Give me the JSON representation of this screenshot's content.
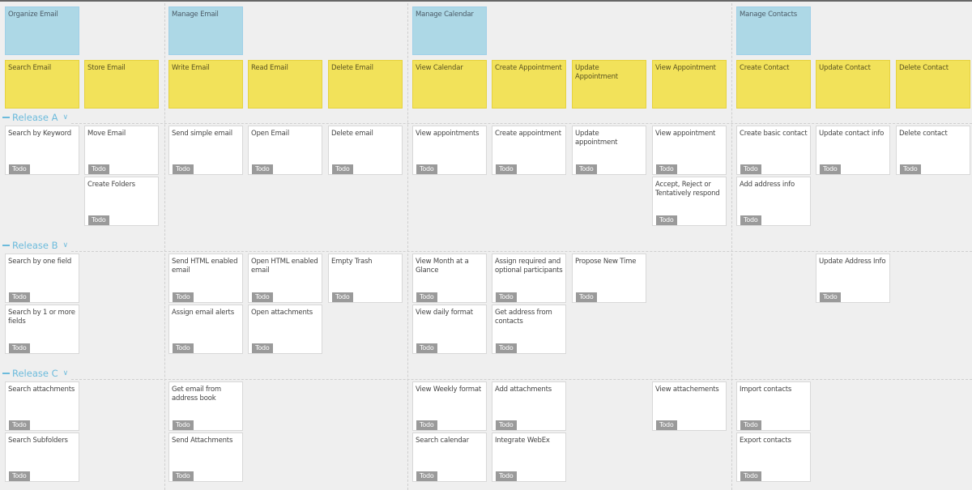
{
  "epics": [
    {
      "label": "Organize Email",
      "col": 0
    },
    {
      "label": "Manage Email",
      "col": 2
    },
    {
      "label": "Manage Calendar",
      "col": 5
    },
    {
      "label": "Manage Contacts",
      "col": 9
    }
  ],
  "features": [
    "Search Email",
    "Store Email",
    "Write Email",
    "Read Email",
    "Delete Email",
    "View Calendar",
    "Create Appointment",
    "Update Appointment",
    "View Appointment",
    "Create Contact",
    "Update Contact",
    "Delete Contact"
  ],
  "status_label": "Todo",
  "releases": [
    {
      "label": "Release A",
      "stories": [
        {
          "col": 0,
          "row": 0,
          "text": "Search by Keyword"
        },
        {
          "col": 1,
          "row": 0,
          "text": "Move Email"
        },
        {
          "col": 1,
          "row": 1,
          "text": "Create Folders"
        },
        {
          "col": 2,
          "row": 0,
          "text": "Send simple email"
        },
        {
          "col": 3,
          "row": 0,
          "text": "Open Email"
        },
        {
          "col": 4,
          "row": 0,
          "text": "Delete email"
        },
        {
          "col": 5,
          "row": 0,
          "text": "View appointments"
        },
        {
          "col": 6,
          "row": 0,
          "text": "Create appointment"
        },
        {
          "col": 7,
          "row": 0,
          "text": "Update appointment"
        },
        {
          "col": 8,
          "row": 0,
          "text": "View appointment"
        },
        {
          "col": 8,
          "row": 1,
          "text": "Accept, Reject or Tentatively respond"
        },
        {
          "col": 9,
          "row": 0,
          "text": "Create basic contact"
        },
        {
          "col": 9,
          "row": 1,
          "text": "Add address info"
        },
        {
          "col": 10,
          "row": 0,
          "text": "Update contact info"
        },
        {
          "col": 11,
          "row": 0,
          "text": "Delete contact"
        }
      ]
    },
    {
      "label": "Release B",
      "stories": [
        {
          "col": 0,
          "row": 0,
          "text": "Search by one field"
        },
        {
          "col": 0,
          "row": 1,
          "text": "Search by 1 or more fields"
        },
        {
          "col": 2,
          "row": 0,
          "text": "Send HTML enabled email"
        },
        {
          "col": 2,
          "row": 1,
          "text": "Assign email alerts"
        },
        {
          "col": 3,
          "row": 0,
          "text": "Open HTML enabled email"
        },
        {
          "col": 3,
          "row": 1,
          "text": "Open attachments"
        },
        {
          "col": 4,
          "row": 0,
          "text": "Empty Trash"
        },
        {
          "col": 5,
          "row": 0,
          "text": "View Month at a Glance"
        },
        {
          "col": 5,
          "row": 1,
          "text": "View daily format"
        },
        {
          "col": 6,
          "row": 0,
          "text": "Assign required and optional participants"
        },
        {
          "col": 6,
          "row": 1,
          "text": "Get address from contacts"
        },
        {
          "col": 7,
          "row": 0,
          "text": "Propose New Time"
        },
        {
          "col": 10,
          "row": 0,
          "text": "Update Address Info"
        }
      ]
    },
    {
      "label": "Release C",
      "stories": [
        {
          "col": 0,
          "row": 0,
          "text": "Search attachments"
        },
        {
          "col": 0,
          "row": 1,
          "text": "Search Subfolders"
        },
        {
          "col": 2,
          "row": 0,
          "text": "Get email from address book"
        },
        {
          "col": 2,
          "row": 1,
          "text": "Send Attachments"
        },
        {
          "col": 5,
          "row": 0,
          "text": "View Weekly format"
        },
        {
          "col": 5,
          "row": 1,
          "text": "Search calendar"
        },
        {
          "col": 6,
          "row": 0,
          "text": "Add attachments"
        },
        {
          "col": 6,
          "row": 1,
          "text": "Integrate WebEx"
        },
        {
          "col": 8,
          "row": 0,
          "text": "View attachements"
        },
        {
          "col": 9,
          "row": 0,
          "text": "Import contacts"
        },
        {
          "col": 9,
          "row": 1,
          "text": "Export contacts"
        }
      ]
    }
  ],
  "colors": {
    "epic": "#add8e6",
    "feature": "#f2e25a",
    "release_label": "#6cbbdc",
    "badge": "#9a9a9a"
  }
}
